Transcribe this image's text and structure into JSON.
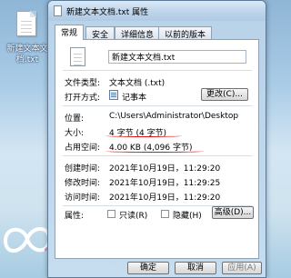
{
  "desktop": {
    "file_label": "新建文本文档.txt"
  },
  "window": {
    "title": "新建文本文档.txt 属性"
  },
  "tabs": [
    {
      "label": "常规"
    },
    {
      "label": "安全"
    },
    {
      "label": "详细信息"
    },
    {
      "label": "以前的版本"
    }
  ],
  "general": {
    "filename": "新建文本文档.txt",
    "rows": {
      "file_type": {
        "label": "文件类型:",
        "value": "文本文档 (.txt)"
      },
      "opens_with": {
        "label": "打开方式:",
        "value": "记事本",
        "button": "更改(C)..."
      },
      "location": {
        "label": "位置:",
        "value": "C:\\Users\\Administrator\\Desktop"
      },
      "size": {
        "label": "大小:",
        "value": "4 字节 (4 字节)"
      },
      "size_on_disk": {
        "label": "占用空间:",
        "value": "4.00 KB (4,096 字节)"
      },
      "created": {
        "label": "创建时间:",
        "value": "2021年10月19日，11:29:20"
      },
      "modified": {
        "label": "修改时间:",
        "value": "2021年10月19日，11:29:25"
      },
      "accessed": {
        "label": "访问时间:",
        "value": "2021年10月19日，11:29:20"
      }
    },
    "attributes": {
      "label": "属性:",
      "readonly": "只读(R)",
      "hidden": "隐藏(H)",
      "advanced": "高级(D)..."
    }
  },
  "buttons": {
    "ok": "确定",
    "cancel": "取消",
    "apply": "应用(A)"
  },
  "colors": {
    "annotation_red": "#d11111"
  }
}
